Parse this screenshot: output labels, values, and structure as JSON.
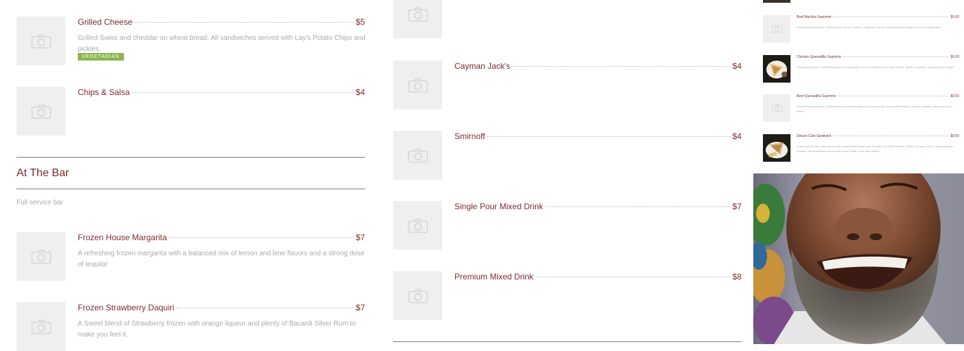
{
  "left_column": {
    "items_top": [
      {
        "name": "Grilled Cheese",
        "price": "$5",
        "description": "Grilled Swiss and cheddar on wheat bread. All sandwiches served with Lay's Potato Chips and pickles.",
        "tag": "VEGETARIAN"
      },
      {
        "name": "Chips & Salsa",
        "price": "$4"
      }
    ],
    "section": {
      "title": "At The Bar",
      "subtitle": "Full service bar"
    },
    "items_bar": [
      {
        "name": "Frozen House Margarita",
        "price": "$7",
        "description": "A refreshing frozen margarita with a balanced mix of lemon and lime flavors and a strong dose of tequila!"
      },
      {
        "name": "Frozen Strawberry Daquiri",
        "price": "$7",
        "description": "A Sweet blend of Strawberry frozen with orange liqueur and plenty of Bacardi Silver Rum to make you feel it."
      }
    ]
  },
  "middle_column": {
    "items": [
      {
        "name": "Cayman Jack's",
        "price": "$4"
      },
      {
        "name": "Smirnoff",
        "price": "$4"
      },
      {
        "name": "Single Pour Mixed Drink",
        "price": "$7"
      },
      {
        "name": "Premium Mixed Drink",
        "price": "$8"
      }
    ]
  },
  "right_column": {
    "items": [
      {
        "name": "Beef Nachos Supreme",
        "price": "$9.50",
        "description": "Seasoned ground beef, refried beans, lettuce, cilantro, scallions, cheese, salsa and sour cream served on tortilla chips.",
        "thumb": "camera-icon"
      },
      {
        "name": "Chicken Quesadilla Supreme",
        "price": "$9.50",
        "description": "Seasoned chicken, refried beans and cheese grilled on a soft tortilla, served with lettuce, cilantro, scallions, salsa and sour cream.",
        "thumb": "food-photo"
      },
      {
        "name": "Beef Quesadilla Supreme",
        "price": "$9.50",
        "description": "Seasoned ground beef, refried beans and cheese grilled on a soft tortilla, served with lettuce, cilantro, scallions, salsa and sour cream.",
        "thumb": "camera-icon"
      },
      {
        "name": "Deluxe Club Sandwich",
        "price": "$9.50",
        "description": "Grilled turkey, ham, and bacon built on triple wheat toast with cheddar and Swiss cheese, lettuce, tomato, onion, mayo and spicy mustard. All sandwiches served with Lay's Potato Chips and pickles.",
        "thumb": "food-photo"
      }
    ]
  },
  "colors": {
    "accent": "#7a2a2f",
    "tag": "#8db550",
    "placeholder": "#efefef",
    "muted": "#aaaaaa"
  }
}
